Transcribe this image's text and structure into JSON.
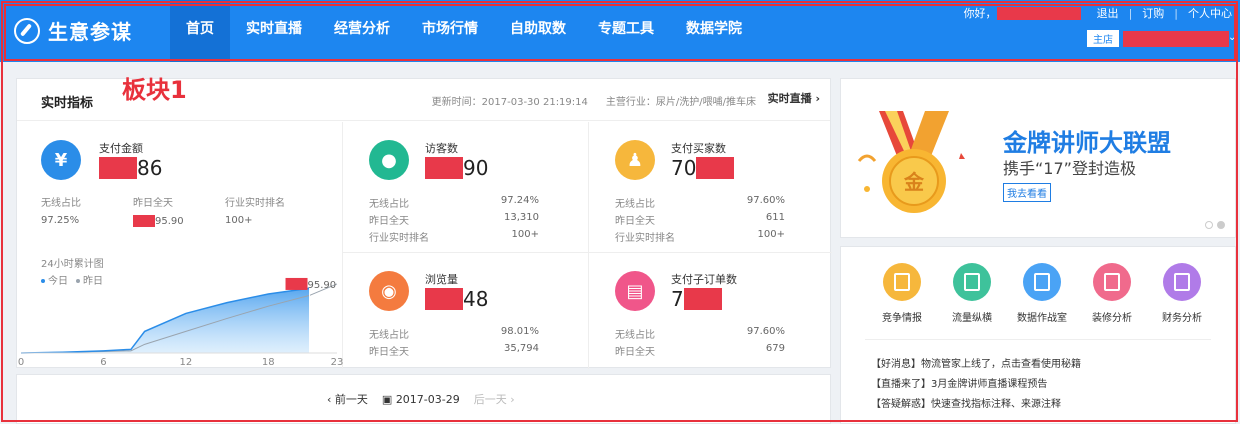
{
  "header": {
    "logo": "生意参谋",
    "nav": [
      "首页",
      "实时直播",
      "经营分析",
      "市场行情",
      "自助取数",
      "专题工具",
      "数据学院"
    ],
    "greeting": "你好，",
    "logout": "退出",
    "order": "订购",
    "user_center": "个人中心",
    "shop_tag": "主店",
    "colors": {
      "bar": "#1d86f0",
      "active": "#1471d6"
    }
  },
  "annotation": "板块1",
  "metrics": {
    "title": "实时指标",
    "update_time": "更新时间：2017-03-30 21:19:14",
    "industry": "主营行业：尿片/洗护/喂哺/推车床",
    "live_link": "实时直播",
    "pay": {
      "name": "支付金额",
      "value_tail": "86",
      "icon": "yen-icon",
      "labels": [
        "无线占比",
        "昨日全天",
        "行业实时排名"
      ],
      "values": [
        "97.25%",
        "95.90",
        "100+"
      ]
    },
    "visitors": {
      "name": "访客数",
      "value_tail": "90",
      "icon": "footprint-icon",
      "rows": [
        [
          "无线占比",
          "97.24%"
        ],
        [
          "昨日全天",
          "13,310"
        ],
        [
          "行业实时排名",
          "100+"
        ]
      ]
    },
    "buyers": {
      "name": "支付买家数",
      "value_head": "70",
      "icon": "user-group-icon",
      "rows": [
        [
          "无线占比",
          "97.60%"
        ],
        [
          "昨日全天",
          "611"
        ],
        [
          "行业实时排名",
          "100+"
        ]
      ]
    },
    "pageviews": {
      "name": "浏览量",
      "value_tail": "48",
      "icon": "eye-icon",
      "rows": [
        [
          "无线占比",
          "98.01%"
        ],
        [
          "昨日全天",
          "35,794"
        ]
      ]
    },
    "suborders": {
      "name": "支付子订单数",
      "value_head": "7",
      "icon": "clipboard-icon",
      "rows": [
        [
          "无线占比",
          "97.60%"
        ],
        [
          "昨日全天",
          "679"
        ]
      ]
    }
  },
  "chart_data": {
    "type": "area",
    "title": "24小时累计图",
    "x_ticks": [
      "0",
      "6",
      "12",
      "18",
      "23"
    ],
    "series": [
      {
        "name": "今日",
        "x": [
          0,
          3,
          6,
          8,
          9,
          12,
          15,
          18,
          21
        ],
        "y": [
          0,
          1,
          3,
          5,
          30,
          55,
          70,
          82,
          90
        ]
      },
      {
        "name": "昨日",
        "x": [
          0,
          3,
          6,
          8,
          9,
          12,
          15,
          18,
          21,
          23
        ],
        "y": [
          0,
          1,
          2,
          3,
          12,
          30,
          48,
          65,
          80,
          95.9
        ]
      }
    ],
    "annotation": "95.90",
    "ylim": [
      0,
      100
    ],
    "colors": {
      "today": "#2b8de8",
      "yesterday": "#9aa4ae"
    }
  },
  "datebar": {
    "prev": "前一天",
    "date": "2017-03-29",
    "next": "后一天"
  },
  "banner": {
    "title": "金牌讲师大联盟",
    "subtitle": "携手“17”登封造极",
    "button": "我去看看",
    "medal_char": "金"
  },
  "tools": [
    {
      "label": "竞争情报",
      "color": "#f6b73c"
    },
    {
      "label": "流量纵横",
      "color": "#3ec29b"
    },
    {
      "label": "数据作战室",
      "color": "#4aa3f5"
    },
    {
      "label": "装修分析",
      "color": "#f06a8c"
    },
    {
      "label": "财务分析",
      "color": "#b07be8"
    }
  ],
  "news": [
    "【好消息】物流管家上线了，点击查看使用秘籍",
    "【直播来了】3月金牌讲师直播课程预告",
    "【答疑解惑】快速查找指标注释、来源注释"
  ]
}
